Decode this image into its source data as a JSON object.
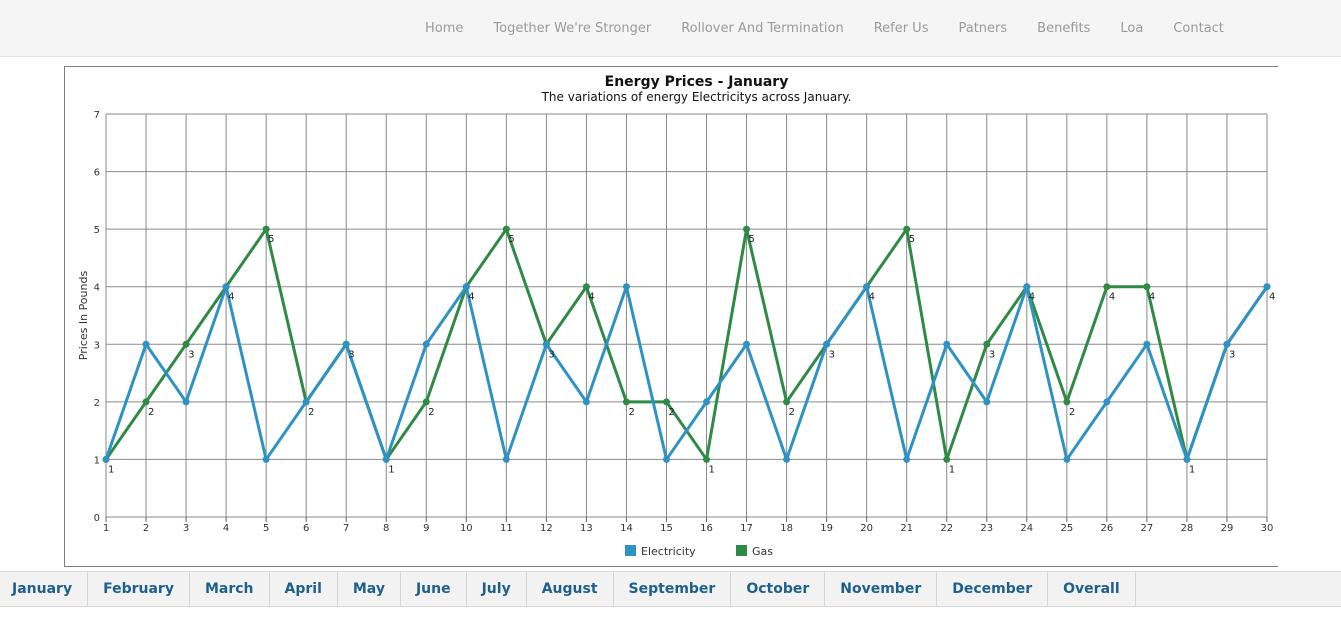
{
  "nav": {
    "items": [
      {
        "label": "Home"
      },
      {
        "label": "Together We're Stronger"
      },
      {
        "label": "Rollover And Termination"
      },
      {
        "label": "Refer Us"
      },
      {
        "label": "Patners"
      },
      {
        "label": "Benefits"
      },
      {
        "label": "Loa"
      },
      {
        "label": "Contact"
      }
    ]
  },
  "tabs": [
    {
      "label": "January"
    },
    {
      "label": "February"
    },
    {
      "label": "March"
    },
    {
      "label": "April"
    },
    {
      "label": "May"
    },
    {
      "label": "June"
    },
    {
      "label": "July"
    },
    {
      "label": "August"
    },
    {
      "label": "September"
    },
    {
      "label": "October"
    },
    {
      "label": "November"
    },
    {
      "label": "December"
    },
    {
      "label": "Overall"
    }
  ],
  "chart_data": {
    "type": "line",
    "title": "Energy Prices - January",
    "subtitle": "The variations of energy Electricitys across January.",
    "xlabel": "",
    "ylabel": "Prices In Pounds",
    "x": [
      1,
      2,
      3,
      4,
      5,
      6,
      7,
      8,
      9,
      10,
      11,
      12,
      13,
      14,
      15,
      16,
      17,
      18,
      19,
      20,
      21,
      22,
      23,
      24,
      25,
      26,
      27,
      28,
      29,
      30
    ],
    "ylim": [
      0,
      7
    ],
    "yticks": [
      0,
      1,
      2,
      3,
      4,
      5,
      6,
      7
    ],
    "grid": true,
    "legend_position": "bottom-center",
    "series": [
      {
        "name": "Electricity",
        "color": "#2e93c4",
        "values": [
          1,
          3,
          2,
          4,
          1,
          2,
          3,
          1,
          3,
          4,
          1,
          3,
          2,
          4,
          1,
          2,
          3,
          1,
          3,
          4,
          1,
          3,
          2,
          4,
          1,
          2,
          3,
          1,
          3,
          4
        ]
      },
      {
        "name": "Gas",
        "color": "#2f8a45",
        "values": [
          1,
          2,
          3,
          4,
          5,
          2,
          3,
          1,
          2,
          4,
          5,
          3,
          4,
          2,
          2,
          1,
          5,
          2,
          3,
          4,
          5,
          1,
          3,
          4,
          2,
          4,
          4,
          1,
          3,
          4
        ]
      }
    ],
    "data_labels_series": "Gas"
  }
}
